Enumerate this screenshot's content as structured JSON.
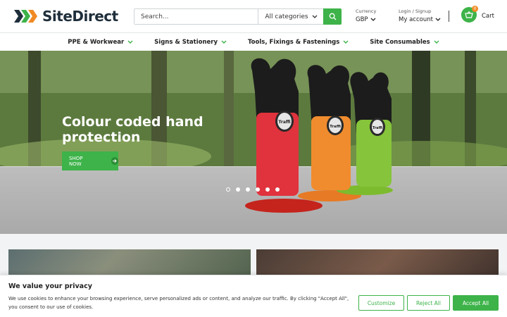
{
  "brand": {
    "name": "SiteDirect",
    "accent": "#3db349",
    "dark": "#1f2e3b"
  },
  "search": {
    "placeholder": "Search...",
    "category": "All categories"
  },
  "currency": {
    "label": "Currency",
    "value": "GBP"
  },
  "account": {
    "label": "Login / Signup",
    "value": "My account"
  },
  "cart": {
    "label": "Cart",
    "count": "0"
  },
  "nav": [
    {
      "label": "PPE & Workwear"
    },
    {
      "label": "Signs & Stationery"
    },
    {
      "label": "Tools, Fixings & Fastenings"
    },
    {
      "label": "Site Consumables"
    }
  ],
  "hero": {
    "headline": "Colour coded hand protection",
    "cta": "SHOP NOW",
    "slides": 6,
    "active_slide": 1,
    "glove_brand": "Traffi"
  },
  "cookie": {
    "title": "We value your privacy",
    "text": "We use cookies to enhance your browsing experience, serve personalized ads or content, and analyze our traffic. By clicking \"Accept All\", you consent to our use of cookies.",
    "customize": "Customize",
    "reject": "Reject All",
    "accept": "Accept All"
  }
}
